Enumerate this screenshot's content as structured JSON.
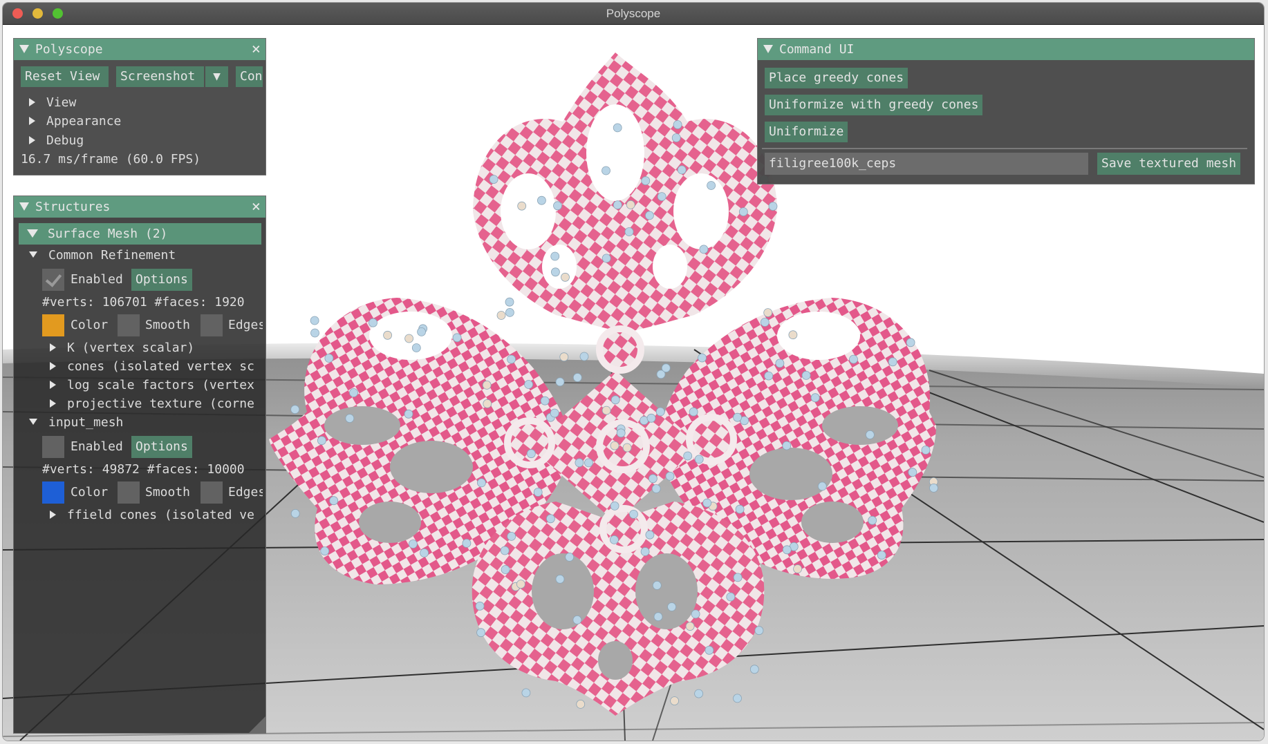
{
  "window": {
    "title": "Polyscope",
    "controls": [
      "close",
      "minimize",
      "zoom"
    ]
  },
  "polyscope_panel": {
    "title": "Polyscope",
    "buttons": {
      "reset_view": "Reset View",
      "screenshot": "Screenshot",
      "screenshot_dropdown": "▼",
      "controls_truncated": "Con"
    },
    "sections": [
      {
        "label": "View",
        "expanded": false
      },
      {
        "label": "Appearance",
        "expanded": false
      },
      {
        "label": "Debug",
        "expanded": false
      }
    ],
    "fps_text": "16.7 ms/frame (60.0 FPS)"
  },
  "structures_panel": {
    "title": "Structures",
    "group": {
      "label": "Surface Mesh (2)",
      "expanded": true
    },
    "meshes": [
      {
        "name": "Common Refinement",
        "expanded": true,
        "enabled": true,
        "enabled_label": "Enabled",
        "options_label": "Options",
        "stats": "#verts: 106701  #faces: 1920",
        "color": "#e29a1f",
        "color_label": "Color",
        "smooth_label": "Smooth",
        "edges_label": "Edges",
        "quantities": [
          "K (vertex scalar)",
          "cones (isolated vertex sc",
          "log scale factors (vertex",
          "projective texture (corne"
        ]
      },
      {
        "name": "input_mesh",
        "expanded": true,
        "enabled": false,
        "enabled_label": "Enabled",
        "options_label": "Options",
        "stats": "#verts: 49872  #faces: 10000",
        "color": "#1e5fd6",
        "color_label": "Color",
        "smooth_label": "Smooth",
        "edges_label": "Edges",
        "quantities": [
          "ffield cones (isolated ve"
        ]
      }
    ]
  },
  "command_panel": {
    "title": "Command UI",
    "buttons": {
      "place_greedy_cones": "Place greedy cones",
      "uniformize_with_greedy_cones": "Uniformize with greedy cones",
      "uniformize": "Uniformize",
      "save_textured_mesh": "Save textured mesh"
    },
    "filename_input": {
      "value": "filigree100k_ceps"
    }
  },
  "scene": {
    "model": "filigree mesh with checkerboard texture",
    "checker_colors": [
      "#e5628e",
      "#f1e6e8"
    ],
    "cone_marker_colors": [
      "#b9d4e6",
      "#eadccb"
    ],
    "sky_color": "#ffffff",
    "floor_color": "#b9b9b9"
  }
}
